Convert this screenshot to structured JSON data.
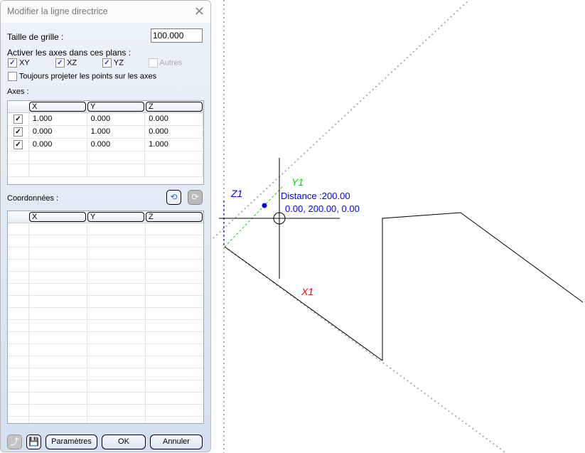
{
  "dialog": {
    "title": "Modifier la ligne directrice",
    "grid_size_label": "Taille de grille :",
    "grid_size_value": "100.000",
    "planes_label": "Activer les axes dans ces plans :",
    "planes": [
      {
        "label": "XY",
        "checked": true
      },
      {
        "label": "XZ",
        "checked": true
      },
      {
        "label": "YZ",
        "checked": true
      },
      {
        "label": "Autres",
        "checked": false,
        "disabled": true
      }
    ],
    "project_label": "Toujours projeter les points sur les axes",
    "axes_label": "Axes :",
    "axes_columns": [
      "X",
      "Y",
      "Z"
    ],
    "axes_rows": [
      [
        "1.000",
        "0.000",
        "0.000"
      ],
      [
        "0.000",
        "1.000",
        "0.000"
      ],
      [
        "0.000",
        "0.000",
        "1.000"
      ]
    ],
    "coords_label": "Coordonnées :",
    "coords_columns": [
      "X",
      "Y",
      "Z"
    ],
    "buttons": {
      "params": "Paramètres",
      "ok": "OK",
      "cancel": "Annuler"
    }
  },
  "viewport": {
    "distance_label": "Distance :200.00",
    "point_coords": "0.00, 200.00, 0.00",
    "axis_x": "X1",
    "axis_y": "Y1",
    "axis_z": "Z1",
    "colors": {
      "x": "#ff0000",
      "y": "#00dd00",
      "z": "#0000ff"
    }
  }
}
